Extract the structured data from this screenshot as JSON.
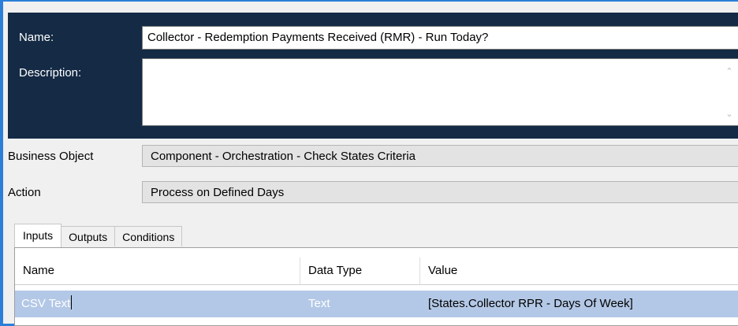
{
  "header": {
    "name_label": "Name:",
    "name_value": "Collector - Redemption Payments Received (RMR) - Run Today?",
    "description_label": "Description:",
    "description_value": ""
  },
  "fields": {
    "business_object_label": "Business Object",
    "business_object_value": "Component - Orchestration - Check States Criteria",
    "action_label": "Action",
    "action_value": "Process on Defined Days"
  },
  "tabs": [
    {
      "label": "Inputs",
      "active": true
    },
    {
      "label": "Outputs",
      "active": false
    },
    {
      "label": "Conditions",
      "active": false
    }
  ],
  "inputs_table": {
    "columns": [
      "Name",
      "Data Type",
      "Value"
    ],
    "rows": [
      {
        "name": "CSV Text",
        "data_type": "Text",
        "value": "[States.Collector RPR - Days Of Week]",
        "selected": true
      }
    ]
  },
  "colors": {
    "header_bg": "#142a45",
    "selection_bg": "#b3c8e6",
    "frame_accent": "#2b7fd8"
  }
}
